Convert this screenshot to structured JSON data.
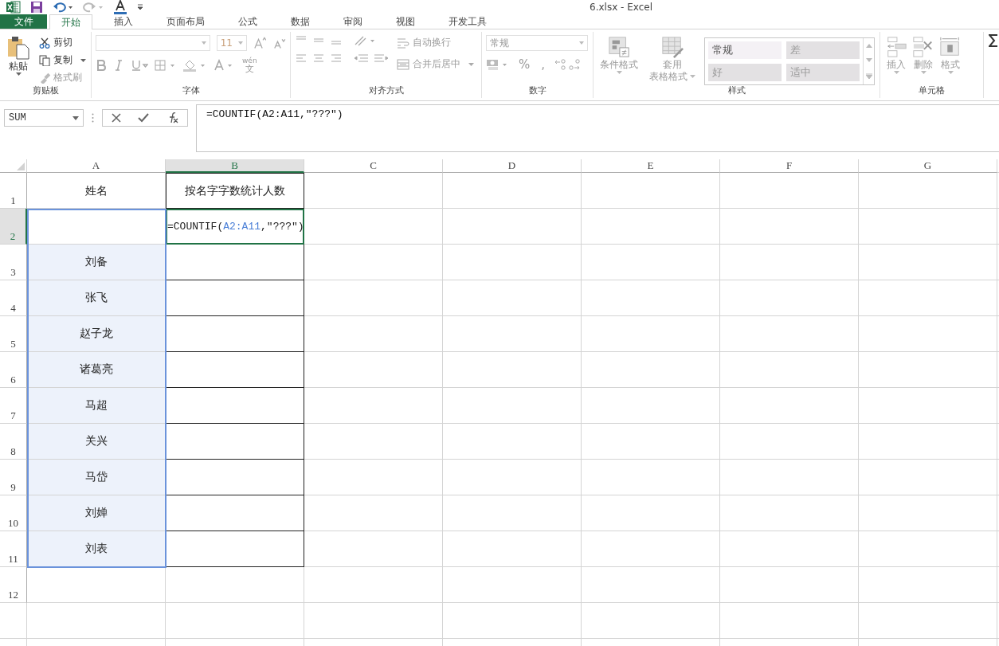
{
  "window": {
    "title": "6.xlsx - Excel"
  },
  "tabs": [
    {
      "label": "文件",
      "kind": "file",
      "selected": false
    },
    {
      "label": "开始",
      "kind": "tab",
      "selected": true
    },
    {
      "label": "插入",
      "kind": "tab",
      "selected": false
    },
    {
      "label": "页面布局",
      "kind": "tab",
      "selected": false
    },
    {
      "label": "公式",
      "kind": "tab",
      "selected": false
    },
    {
      "label": "数据",
      "kind": "tab",
      "selected": false
    },
    {
      "label": "审阅",
      "kind": "tab",
      "selected": false
    },
    {
      "label": "视图",
      "kind": "tab",
      "selected": false
    },
    {
      "label": "开发工具",
      "kind": "tab",
      "selected": false
    }
  ],
  "ribbon": {
    "clipboard": {
      "label": "剪贴板",
      "paste": "粘贴",
      "cut": {
        "label": "剪切",
        "disabled": false
      },
      "copy": {
        "label": "复制",
        "disabled": false
      },
      "format_painter": {
        "label": "格式刷",
        "disabled": true
      }
    },
    "font": {
      "label": "字体",
      "disabled": true,
      "size": "11",
      "phonetic_top": "wén",
      "phonetic_bottom": "文"
    },
    "alignment": {
      "label": "对齐方式",
      "disabled": true,
      "wrap_text": "自动换行",
      "merge_center": "合并后居中"
    },
    "number": {
      "label": "数字",
      "disabled": true,
      "format": "常规",
      "percent": "%",
      "comma": ","
    },
    "styles": {
      "label": "样式",
      "disabled": true,
      "conditional": "条件格式",
      "table_top": "套用",
      "table_bottom": "表格格式",
      "gallery": [
        {
          "label": "常规",
          "selected": true
        },
        {
          "label": "差",
          "selected": false
        },
        {
          "label": "好",
          "selected": false
        },
        {
          "label": "适中",
          "selected": false
        }
      ]
    },
    "cells": {
      "label": "单元格",
      "disabled": true,
      "buttons": [
        "插入",
        "删除",
        "格式"
      ]
    }
  },
  "formula_bar": {
    "name_box": "SUM",
    "formula": "=COUNTIF(A2:A11,\"???\")"
  },
  "columns": [
    {
      "label": "A",
      "selected": false
    },
    {
      "label": "B",
      "selected": true
    },
    {
      "label": "C",
      "selected": false
    },
    {
      "label": "D",
      "selected": false
    },
    {
      "label": "E",
      "selected": false
    },
    {
      "label": "F",
      "selected": false
    },
    {
      "label": "G",
      "selected": false
    }
  ],
  "rows": [
    {
      "number": "1",
      "selected": false,
      "in_range": false,
      "a": "姓名",
      "b": "按名字字数统计人数"
    },
    {
      "number": "2",
      "selected": true,
      "in_range": true,
      "a": "",
      "editing": true,
      "b_parts": [
        {
          "text": "=COUNTIF(",
          "kind": "plain"
        },
        {
          "text": "A2:A11",
          "kind": "ref"
        },
        {
          "text": ",\"???\")",
          "kind": "plain"
        }
      ]
    },
    {
      "number": "3",
      "selected": false,
      "in_range": true,
      "a": "刘备",
      "b": ""
    },
    {
      "number": "4",
      "selected": false,
      "in_range": true,
      "a": "张飞",
      "b": ""
    },
    {
      "number": "5",
      "selected": false,
      "in_range": true,
      "a": "赵子龙",
      "b": ""
    },
    {
      "number": "6",
      "selected": false,
      "in_range": true,
      "a": "诸葛亮",
      "b": ""
    },
    {
      "number": "7",
      "selected": false,
      "in_range": true,
      "a": "马超",
      "b": ""
    },
    {
      "number": "8",
      "selected": false,
      "in_range": true,
      "a": "关兴",
      "b": ""
    },
    {
      "number": "9",
      "selected": false,
      "in_range": true,
      "a": "马岱",
      "b": ""
    },
    {
      "number": "10",
      "selected": false,
      "in_range": true,
      "a": "刘婵",
      "b": ""
    },
    {
      "number": "11",
      "selected": false,
      "in_range": true,
      "a": "刘表",
      "b": ""
    },
    {
      "number": "12",
      "selected": false,
      "in_range": false,
      "a": "",
      "b": ""
    }
  ]
}
